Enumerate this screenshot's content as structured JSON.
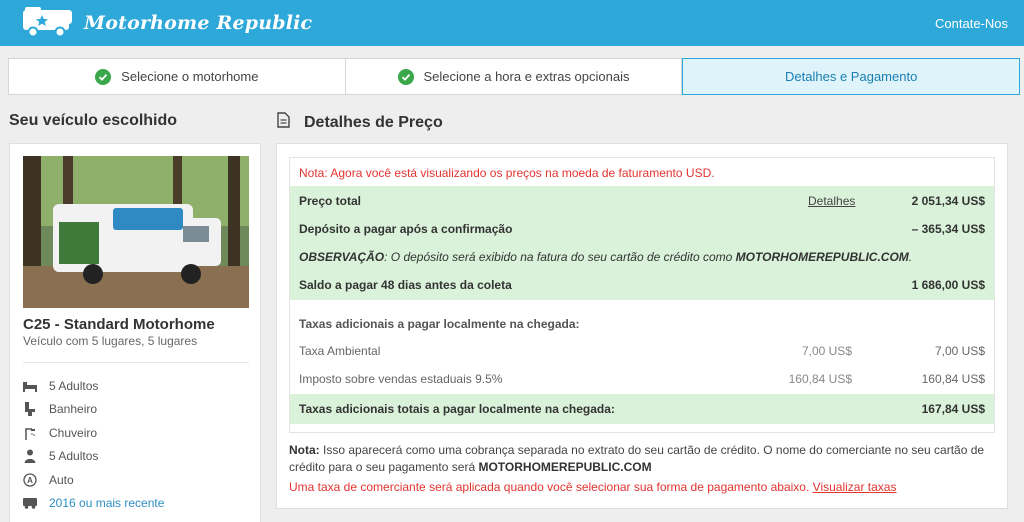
{
  "header": {
    "brand": "Motorhome Republic",
    "contact": "Contate-Nos"
  },
  "steps": [
    {
      "label": "Selecione o motorhome",
      "done": true
    },
    {
      "label": "Selecione a hora e extras opcionais",
      "done": true
    },
    {
      "label": "Detalhes e Pagamento",
      "done": false
    }
  ],
  "vehicle": {
    "section_title": "Seu veículo escolhido",
    "name": "C25 - Standard Motorhome",
    "subtitle": "Veículo com 5 lugares, 5 lugares",
    "features": [
      {
        "icon": "bed-icon",
        "label": "5 Adultos"
      },
      {
        "icon": "toilet-icon",
        "label": "Banheiro"
      },
      {
        "icon": "shower-icon",
        "label": "Chuveiro"
      },
      {
        "icon": "person-icon",
        "label": "5 Adultos"
      },
      {
        "icon": "auto-transmission-icon",
        "label": "Auto"
      },
      {
        "icon": "vehicle-year-icon",
        "label": "2016 ou mais recente"
      }
    ]
  },
  "pricing": {
    "section_title": "Detalhes de Preço",
    "currency_note": "Nota: Agora você está visualizando os preços na moeda de faturamento USD.",
    "total": {
      "label": "Preço total",
      "link": "Detalhes",
      "amount": "2 051,34 US$"
    },
    "deposit": {
      "label": "Depósito a pagar após a confirmação",
      "amount": "– 365,34 US$"
    },
    "observation": {
      "label": "OBSERVAÇÃO",
      "text": ": O depósito será exibido na fatura do seu cartão de crédito como ",
      "merchant": "MOTORHOMEREPUBLIC.COM",
      "end": "."
    },
    "balance": {
      "label": "Saldo a pagar 48 dias antes da coleta",
      "amount": "1 686,00 US$"
    },
    "local_fees_title": "Taxas adicionais a pagar localmente na chegada:",
    "local_fees": [
      {
        "label": "Taxa Ambiental",
        "unit": "7,00 US$",
        "amount": "7,00 US$"
      },
      {
        "label": "Imposto sobre vendas estaduais 9.5%",
        "unit": "160,84 US$",
        "amount": "160,84 US$"
      }
    ],
    "local_total": {
      "label": "Taxas adicionais totais a pagar localmente na chegada:",
      "amount": "167,84 US$"
    },
    "bottom_note": {
      "label": "Nota:",
      "text": " Isso aparecerá como uma cobrança separada no extrato do seu cartão de crédito. O nome do comerciante no seu cartão de crédito para o seu pagamento será ",
      "merchant": "MOTORHOMEREPUBLIC.COM"
    },
    "merchant_fee": {
      "text": "Uma taxa de comerciante será aplicada quando você selecionar sua forma de pagamento abaixo. ",
      "link": "Visualizar taxas"
    }
  },
  "colors": {
    "header": "#2ea8d9",
    "green_row": "#d9f2d9",
    "warning": "#e3342f",
    "active_step": "#dff3fb"
  }
}
